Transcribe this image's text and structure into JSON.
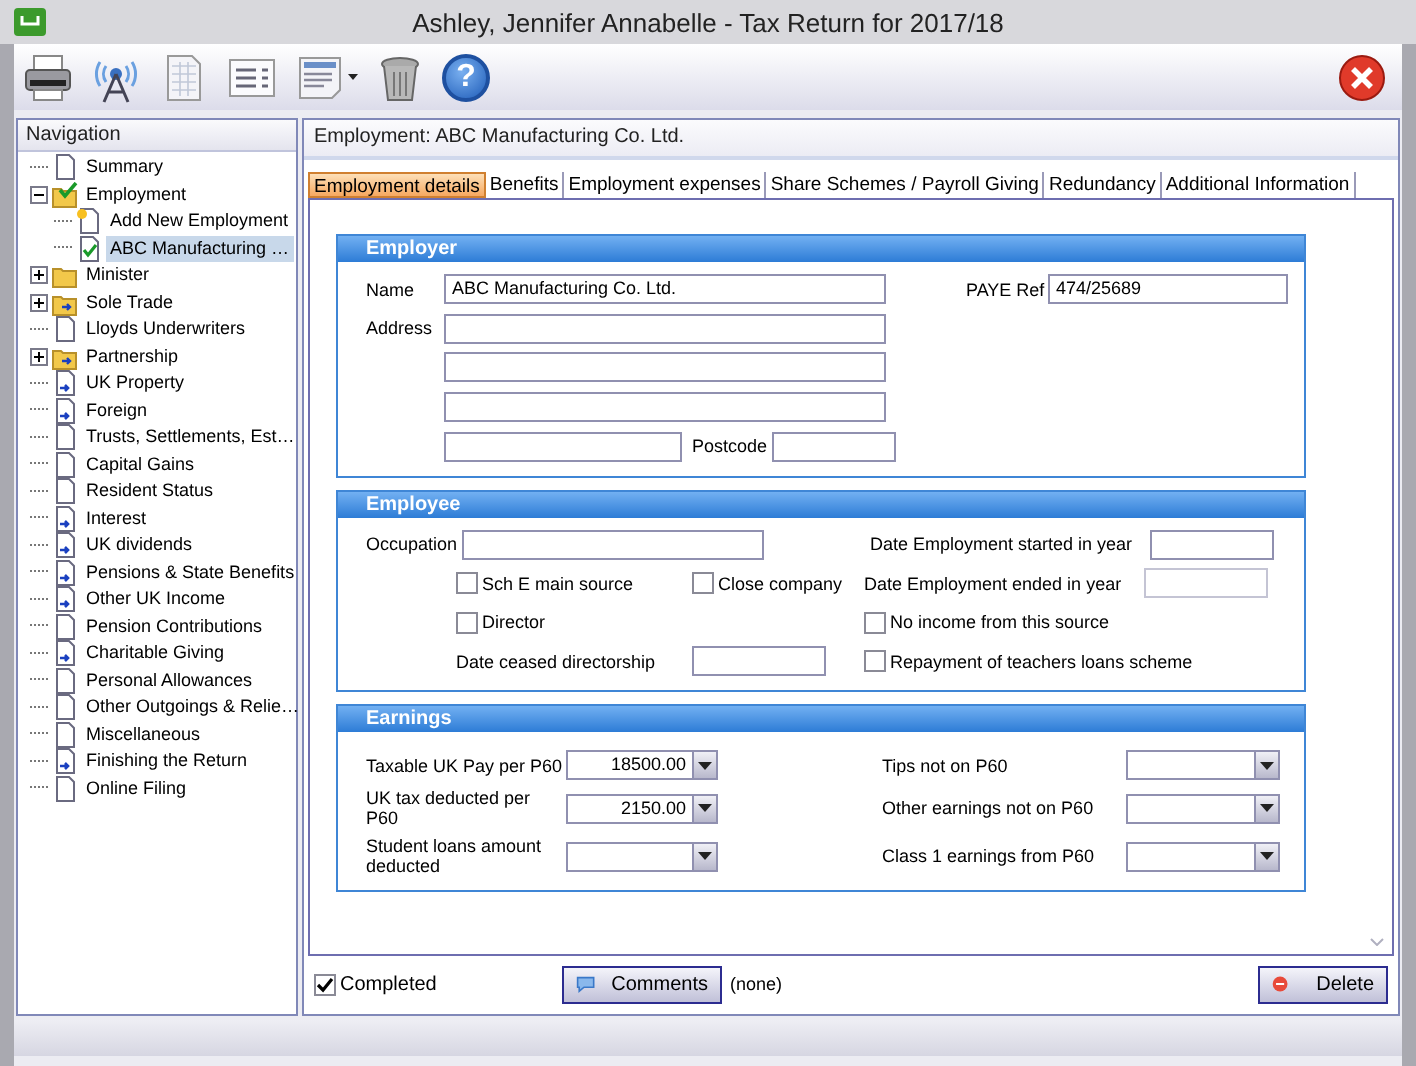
{
  "window": {
    "title": "Ashley, Jennifer Annabelle - Tax Return for 2017/18"
  },
  "toolbar": [
    {
      "kind": "printer"
    },
    {
      "kind": "antenna"
    },
    {
      "kind": "sheet"
    },
    {
      "kind": "list"
    },
    {
      "kind": "form"
    },
    {
      "kind": "trash"
    },
    {
      "kind": "help",
      "glyph": "?"
    }
  ],
  "navigation": {
    "title": "Navigation",
    "items": [
      {
        "label": "Summary",
        "kind": "page",
        "selected": false
      },
      {
        "label": "Employment",
        "kind": "folder-check",
        "selected": false,
        "expanded": true,
        "children": [
          {
            "label": "Add New Employment",
            "kind": "page-new",
            "selected": false
          },
          {
            "label": "ABC Manufacturing …",
            "kind": "page-check",
            "selected": true
          }
        ]
      },
      {
        "label": "Minister",
        "kind": "folder",
        "selected": false,
        "expanded": false
      },
      {
        "label": "Sole Trade",
        "kind": "folder-arrow",
        "selected": false,
        "expanded": false
      },
      {
        "label": "Lloyds Underwriters",
        "kind": "page",
        "selected": false
      },
      {
        "label": "Partnership",
        "kind": "folder-arrow",
        "selected": false,
        "expanded": false
      },
      {
        "label": "UK Property",
        "kind": "page-arrow",
        "selected": false
      },
      {
        "label": "Foreign",
        "kind": "page-arrow",
        "selected": false
      },
      {
        "label": "Trusts, Settlements, Est…",
        "kind": "page",
        "selected": false
      },
      {
        "label": "Capital Gains",
        "kind": "page",
        "selected": false
      },
      {
        "label": "Resident Status",
        "kind": "page",
        "selected": false
      },
      {
        "label": "Interest",
        "kind": "page-arrow",
        "selected": false
      },
      {
        "label": "UK dividends",
        "kind": "page-arrow",
        "selected": false
      },
      {
        "label": "Pensions & State Benefits",
        "kind": "page-arrow",
        "selected": false
      },
      {
        "label": "Other UK Income",
        "kind": "page-arrow",
        "selected": false
      },
      {
        "label": "Pension Contributions",
        "kind": "page",
        "selected": false
      },
      {
        "label": "Charitable Giving",
        "kind": "page-arrow",
        "selected": false
      },
      {
        "label": "Personal Allowances",
        "kind": "page",
        "selected": false
      },
      {
        "label": "Other Outgoings & Relie…",
        "kind": "page",
        "selected": false
      },
      {
        "label": "Miscellaneous",
        "kind": "page",
        "selected": false
      },
      {
        "label": "Finishing the Return",
        "kind": "page-arrow",
        "selected": false
      },
      {
        "label": "Online Filing",
        "kind": "page",
        "selected": false
      }
    ]
  },
  "page": {
    "heading": "Employment: ABC Manufacturing Co. Ltd.",
    "tabs": [
      {
        "label": "Employment details",
        "selected": true
      },
      {
        "label": "Benefits",
        "selected": false
      },
      {
        "label": "Employment expenses",
        "selected": false
      },
      {
        "label": "Share Schemes / Payroll Giving",
        "selected": false
      },
      {
        "label": "Redundancy",
        "selected": false
      },
      {
        "label": "Additional Information",
        "selected": false
      }
    ],
    "employer": {
      "title": "Employer",
      "name_label": "Name",
      "name": "ABC Manufacturing Co. Ltd.",
      "address_label": "Address",
      "postcode_label": "Postcode",
      "paye_label": "PAYE Ref",
      "paye": "474/25689"
    },
    "employee": {
      "title": "Employee",
      "occupation_label": "Occupation",
      "started_label": "Date Employment started in year",
      "ended_label": "Date Employment ended in year",
      "ceased_label": "Date ceased directorship",
      "sch_e": {
        "label": "Sch E main source",
        "checked": false
      },
      "close_company": {
        "label": "Close company",
        "checked": false
      },
      "director": {
        "label": "Director",
        "checked": false
      },
      "no_income": {
        "label": "No income from this source",
        "checked": false
      },
      "teachers_loans": {
        "label": "Repayment of teachers loans scheme",
        "checked": false
      }
    },
    "earnings": {
      "title": "Earnings",
      "left": [
        {
          "label": "Taxable UK Pay per P60",
          "value": "18500.00"
        },
        {
          "label": "UK tax deducted per P60",
          "value": "2150.00"
        },
        {
          "label": "Student loans amount deducted"
        }
      ],
      "right": [
        {
          "label": "Tips not on P60"
        },
        {
          "label": "Other earnings not on P60"
        },
        {
          "label": "Class 1 earnings from P60"
        }
      ]
    },
    "footer": {
      "completed": {
        "label": "Completed",
        "checked": true
      },
      "comments": "Comments",
      "comments_note": "(none)",
      "delete": "Delete"
    }
  }
}
